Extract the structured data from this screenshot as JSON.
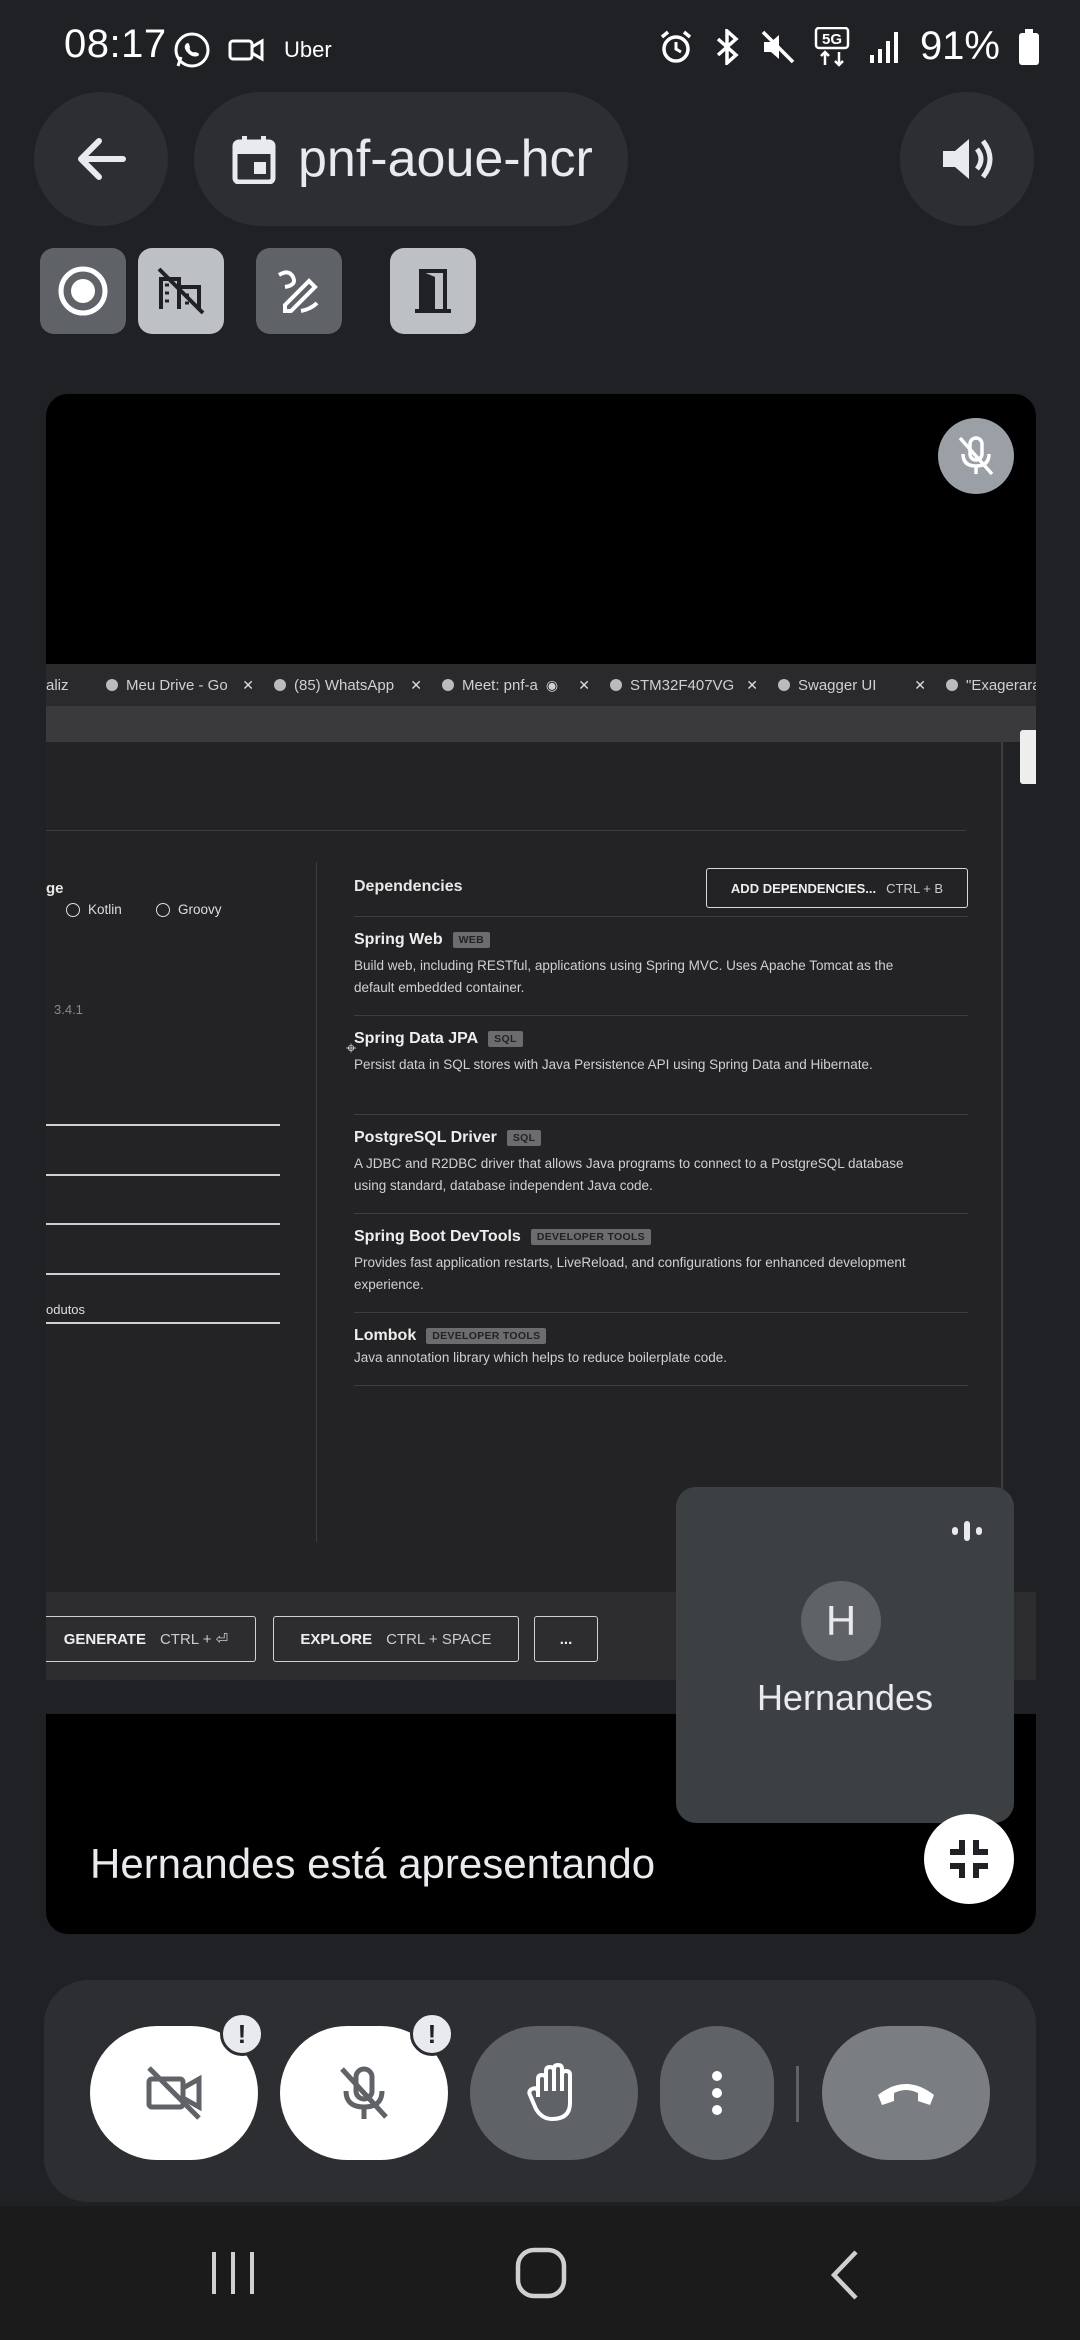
{
  "status_bar": {
    "time": "08:17",
    "left_apps": [
      "whatsapp-icon",
      "video-camera-icon"
    ],
    "uber_label": "Uber",
    "battery": "91%",
    "network": "5G",
    "right_icons": [
      "alarm-icon",
      "bluetooth-icon",
      "mute-icon",
      "5g-icon",
      "signal-icon",
      "battery-icon"
    ]
  },
  "top_bar": {
    "meeting_code": "pnf-aoue-hcr",
    "back_icon": "arrow-left-icon",
    "calendar_icon": "calendar-icon",
    "audio_icon": "speaker-icon"
  },
  "host_controls": [
    "record-icon",
    "no-companion-icon",
    "draw-icon",
    "exit-room-icon"
  ],
  "shared_screen": {
    "tabs": [
      {
        "label": "aliz"
      },
      {
        "label": "Meu Drive - Go"
      },
      {
        "label": "(85) WhatsApp"
      },
      {
        "label": "Meet: pnf-a"
      },
      {
        "label": "STM32F407VG"
      },
      {
        "label": "Swagger UI"
      },
      {
        "label": "\"Exagerara"
      }
    ],
    "language_label": "ge",
    "language_options": [
      "Kotlin",
      "Groovy"
    ],
    "version": "3.4.1",
    "field_value": "odutos",
    "dependencies_title": "Dependencies",
    "add_dependencies_label": "ADD DEPENDENCIES...",
    "add_dependencies_shortcut": "CTRL + B",
    "dependencies": [
      {
        "name": "Spring Web",
        "badge": "WEB",
        "description": "Build web, including RESTful, applications using Spring MVC. Uses Apache Tomcat as the default embedded container."
      },
      {
        "name": "Spring Data JPA",
        "badge": "SQL",
        "description": "Persist data in SQL stores with Java Persistence API using Spring Data and Hibernate."
      },
      {
        "name": "PostgreSQL Driver",
        "badge": "SQL",
        "description": "A JDBC and R2DBC driver that allows Java programs to connect to a PostgreSQL database using standard, database independent Java code."
      },
      {
        "name": "Spring Boot DevTools",
        "badge": "DEVELOPER TOOLS",
        "description": "Provides fast application restarts, LiveReload, and configurations for enhanced development experience."
      },
      {
        "name": "Lombok",
        "badge": "DEVELOPER TOOLS",
        "description": "Java annotation library which helps to reduce boilerplate code."
      }
    ],
    "generate_label": "GENERATE",
    "generate_shortcut": "CTRL + ⏎",
    "explore_label": "EXPLORE",
    "explore_shortcut": "CTRL + SPACE",
    "more_label": "..."
  },
  "participant": {
    "initial": "H",
    "name": "Hernandes"
  },
  "presenting_text": "Hernandes está apresentando",
  "call_controls": {
    "camera": "camera-off-icon",
    "mic": "mic-off-icon",
    "raise_hand": "raise-hand-icon",
    "more": "more-vert-icon",
    "hangup": "hang-up-icon",
    "warning": "!"
  },
  "nav_bar": [
    "recent-apps-icon",
    "home-icon",
    "back-icon"
  ]
}
